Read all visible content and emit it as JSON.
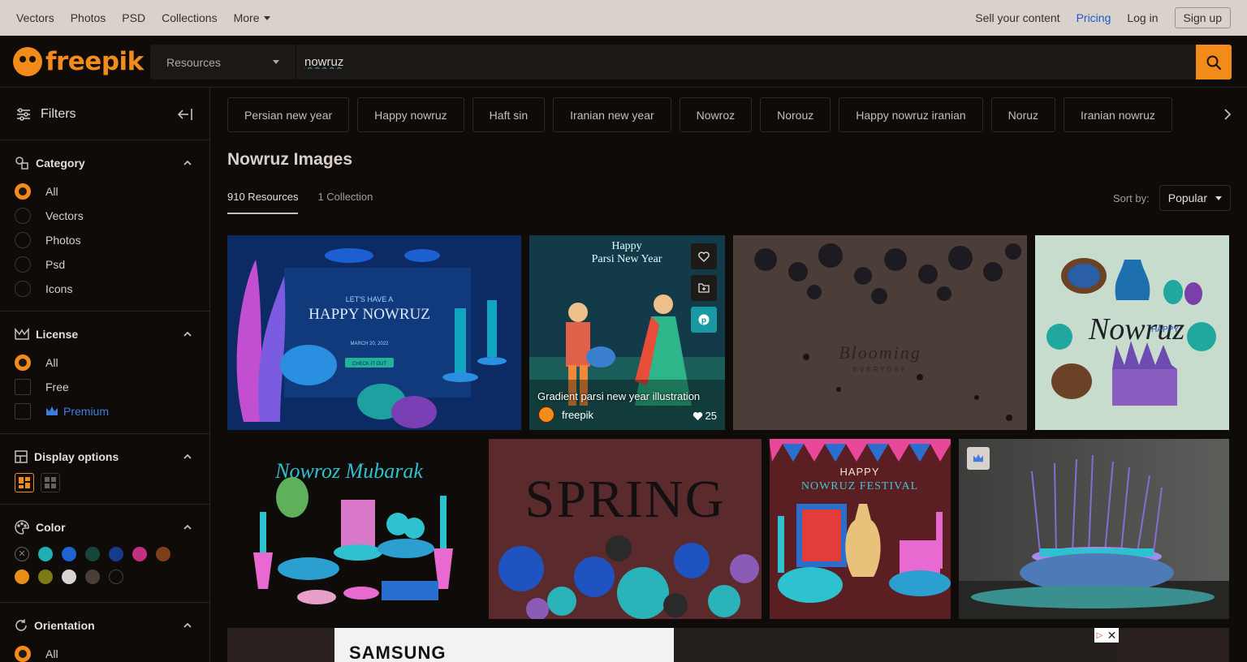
{
  "topbar": {
    "nav": [
      "Vectors",
      "Photos",
      "PSD",
      "Collections"
    ],
    "more_label": "More",
    "sell_label": "Sell your content",
    "pricing_label": "Pricing",
    "login_label": "Log in",
    "signup_label": "Sign up"
  },
  "header": {
    "logo_text": "freepik",
    "resource_select": "Resources",
    "search_value": "nowruz"
  },
  "sidebar": {
    "filters_label": "Filters",
    "category": {
      "title": "Category",
      "options": [
        "All",
        "Vectors",
        "Photos",
        "Psd",
        "Icons"
      ],
      "selected": "All"
    },
    "license": {
      "title": "License",
      "all_label": "All",
      "free_label": "Free",
      "premium_label": "Premium"
    },
    "display": {
      "title": "Display options"
    },
    "color": {
      "title": "Color",
      "swatches": [
        "#1fb1b2",
        "#1f63d0",
        "#17443c",
        "#163a8c",
        "#c2317f",
        "#7d3f1a",
        "#e88f16",
        "#7b7a16",
        "#d9d4d1",
        "#4a3f38",
        "#0e0b09"
      ]
    },
    "orientation": {
      "title": "Orientation",
      "all_label": "All"
    }
  },
  "main": {
    "tags": [
      "Persian new year",
      "Happy nowruz",
      "Haft sin",
      "Iranian new year",
      "Nowroz",
      "Norouz",
      "Happy nowruz iranian",
      "Noruz",
      "Iranian nowruz"
    ],
    "page_title": "Nowruz Images",
    "tabs": [
      "910 Resources",
      "1 Collection"
    ],
    "sort_label": "Sort by:",
    "sort_value": "Popular",
    "hover_card": {
      "title": "Gradient parsi new year illustration",
      "author": "freepik",
      "likes": "25"
    },
    "image_text": {
      "img1_line1": "LET'S HAVE A",
      "img1_line2": "HAPPY NOWRUZ",
      "img1_date": "MARCH 20, 2022",
      "img1_btn": "CHECK IT OUT",
      "img2_line1": "Happy",
      "img2_line2": "Parsi New Year",
      "img3_text": "Blooming",
      "img3_sub": "EVERYDAY",
      "img4_happy": "HAPPY",
      "img4_word": "Nowruz",
      "img5_text": "Nowroz Mubarak",
      "img6_text": "SPRING",
      "img7_line1": "HAPPY",
      "img7_line2": "NOWRUZ FESTIVAL"
    },
    "ad_brand": "SAMSUNG"
  }
}
